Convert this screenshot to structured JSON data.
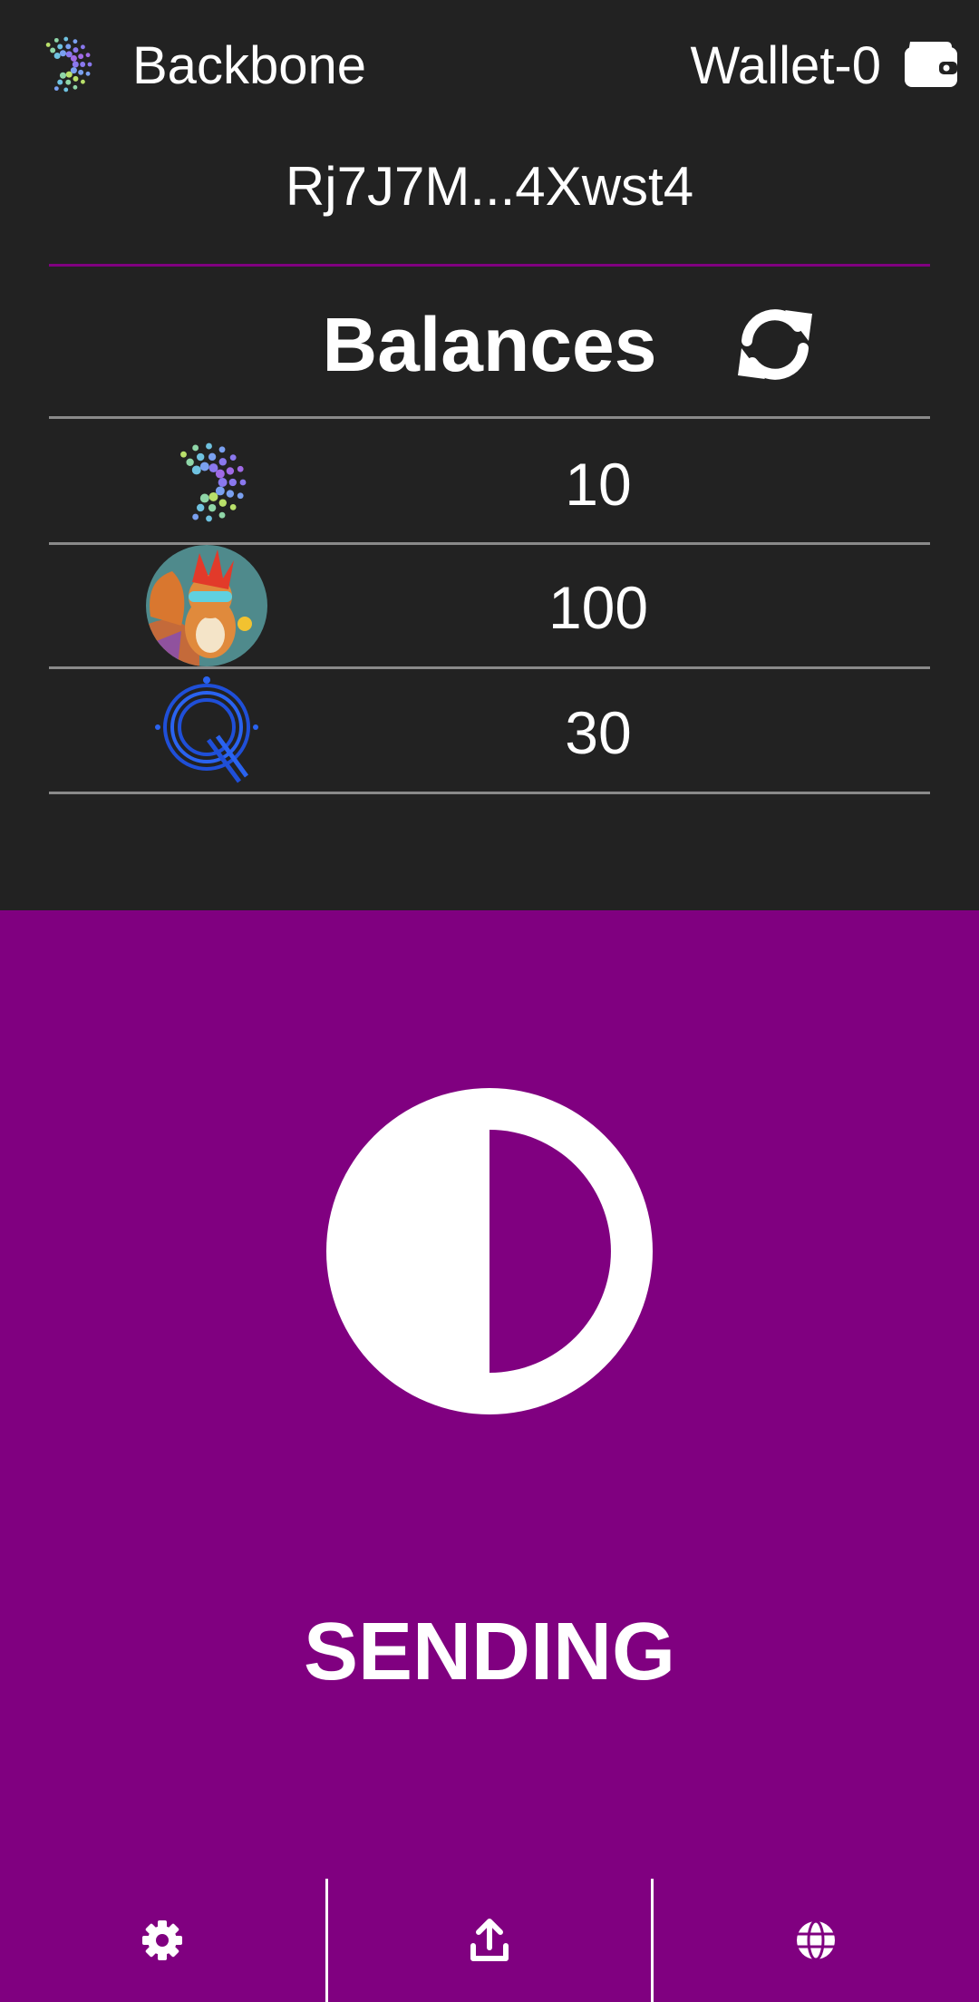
{
  "header": {
    "app_name": "Backbone",
    "wallet_name": "Wallet-0",
    "logo_icon": "backbone-logo",
    "wallet_icon": "wallet-icon"
  },
  "account": {
    "address": "Rj7J7M...4Xwst4"
  },
  "balances": {
    "title": "Balances",
    "refresh_icon": "refresh-icon",
    "rows": [
      {
        "token_icon": "backbone-token-icon",
        "value": "10"
      },
      {
        "token_icon": "squirrel-token-icon",
        "value": "100"
      },
      {
        "token_icon": "q-token-icon",
        "value": "30"
      }
    ]
  },
  "status": {
    "label": "SENDING",
    "icon": "half-circle-icon"
  },
  "nav": {
    "items": [
      {
        "icon": "gear-icon"
      },
      {
        "icon": "upload-icon"
      },
      {
        "icon": "globe-icon"
      }
    ]
  },
  "colors": {
    "background_dark": "#222222",
    "accent_purple": "#800080",
    "divider_gray": "#8a8a8a",
    "text": "#ffffff"
  }
}
